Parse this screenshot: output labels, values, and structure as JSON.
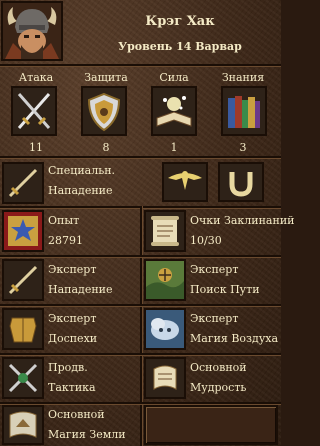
{
  "hero": {
    "name": "Крэг Хак",
    "subtitle": "Уровень 14 Варвар"
  },
  "primary": [
    {
      "label": "Атака",
      "value": "11",
      "icon": "attack-swords-icon"
    },
    {
      "label": "Защита",
      "value": "8",
      "icon": "defense-shield-icon"
    },
    {
      "label": "Сила",
      "value": "1",
      "icon": "spellpower-book-icon"
    },
    {
      "label": "Знания",
      "value": "3",
      "icon": "knowledge-books-icon"
    }
  ],
  "specialty": {
    "label": "Специальн.",
    "value": "Нападение"
  },
  "experience": {
    "label": "Опыт",
    "value": "28791"
  },
  "spell_points": {
    "label": "Очки Заклинаний",
    "value": "10/30"
  },
  "skills": [
    {
      "level": "Эксперт",
      "name": "Нападение",
      "icon": "offense-sword-icon"
    },
    {
      "level": "Эксперт",
      "name": "Поиск Пути",
      "icon": "pathfinding-icon"
    },
    {
      "level": "Эксперт",
      "name": "Доспехи",
      "icon": "armorer-icon"
    },
    {
      "level": "Эксперт",
      "name": "Магия Воздуха",
      "icon": "air-magic-icon"
    },
    {
      "level": "Продв.",
      "name": "Тактика",
      "icon": "tactics-icon"
    },
    {
      "level": "Основной",
      "name": "Мудрость",
      "icon": "wisdom-scroll-icon"
    },
    {
      "level": "Основной",
      "name": "Магия Земли",
      "icon": "earth-magic-icon"
    }
  ]
}
